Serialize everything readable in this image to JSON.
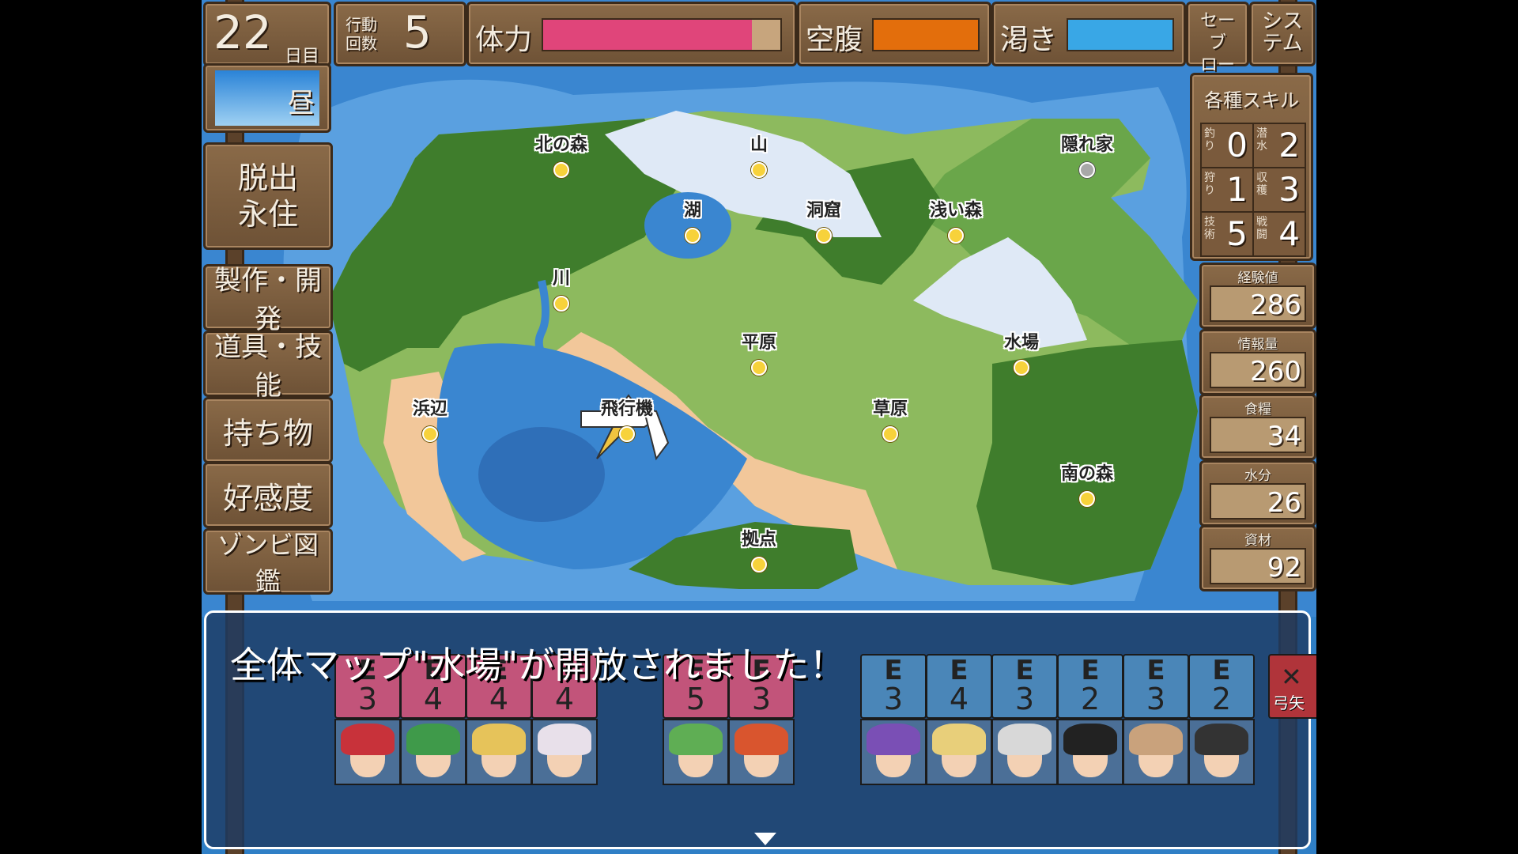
{
  "status": {
    "day_number": "22",
    "day_unit": "日目",
    "time_of_day": "昼",
    "actions_label_line1": "行動",
    "actions_label_line2": "回数",
    "actions_count": "5",
    "stamina_label": "体力",
    "stamina_level": 0.88,
    "hunger_label": "空腹",
    "hunger_level": 1.0,
    "thirst_label": "渇き",
    "thirst_level": 1.0,
    "save_label_line1": "セーブ",
    "save_label_line2": "ロード",
    "system_label_line1": "シス",
    "system_label_line2": "テム",
    "colors": {
      "stamina": "#e0457a",
      "hunger": "#e36e0c",
      "thirst": "#39a7e6"
    }
  },
  "menu": {
    "escape_line1": "脱出",
    "escape_line2": "永住",
    "items": [
      "製作・開発",
      "道具・技能",
      "持ち物",
      "好感度",
      "ゾンビ図鑑"
    ]
  },
  "skills": {
    "title": "各種スキル",
    "cells": [
      {
        "tag": "釣り",
        "value": "0"
      },
      {
        "tag": "潜水",
        "value": "2"
      },
      {
        "tag": "狩り",
        "value": "1"
      },
      {
        "tag": "収穫",
        "value": "3"
      },
      {
        "tag": "技術",
        "value": "5"
      },
      {
        "tag": "戦闘",
        "value": "4"
      }
    ]
  },
  "resources": [
    {
      "label": "経験値",
      "value": "286"
    },
    {
      "label": "情報量",
      "value": "260"
    },
    {
      "label": "食糧",
      "value": "34"
    },
    {
      "label": "水分",
      "value": "26"
    },
    {
      "label": "資材",
      "value": "92"
    }
  ],
  "map": {
    "locations": [
      {
        "name": "北の森",
        "id": "north-forest"
      },
      {
        "name": "山",
        "id": "mountain"
      },
      {
        "name": "隠れ家",
        "id": "hideout",
        "locked": true
      },
      {
        "name": "湖",
        "id": "lake"
      },
      {
        "name": "洞窟",
        "id": "cave"
      },
      {
        "name": "浅い森",
        "id": "shallow-forest"
      },
      {
        "name": "川",
        "id": "river"
      },
      {
        "name": "平原",
        "id": "plains"
      },
      {
        "name": "水場",
        "id": "water-spot"
      },
      {
        "name": "浜辺",
        "id": "beach"
      },
      {
        "name": "飛行機",
        "id": "airplane"
      },
      {
        "name": "草原",
        "id": "grassland"
      },
      {
        "name": "南の森",
        "id": "south-forest"
      },
      {
        "name": "拠点",
        "id": "base"
      }
    ]
  },
  "message": {
    "text": "全体マップ\"水場\"が開放されました！"
  },
  "party": {
    "group1": [
      {
        "e": "E",
        "num": "3",
        "hair": "#c8323a"
      },
      {
        "e": "E",
        "num": "4",
        "hair": "#3f9a4a"
      },
      {
        "e": "E",
        "num": "4",
        "hair": "#e6c35a"
      },
      {
        "e": "E",
        "num": "4",
        "hair": "#e8e0ea"
      }
    ],
    "group2": [
      {
        "e": "E",
        "num": "5",
        "hair": "#5fae54"
      },
      {
        "e": "E",
        "num": "3",
        "hair": "#d9552e"
      }
    ],
    "group3": [
      {
        "e": "E",
        "num": "3",
        "hair": "#7a4fb5"
      },
      {
        "e": "E",
        "num": "4",
        "hair": "#e8cf7a"
      },
      {
        "e": "E",
        "num": "3",
        "hair": "#d8d8d8"
      },
      {
        "e": "E",
        "num": "2",
        "hair": "#222222"
      },
      {
        "e": "E",
        "num": "3",
        "hair": "#c9a27c"
      },
      {
        "e": "E",
        "num": "2",
        "hair": "#333333"
      }
    ],
    "weapon_label": "弓矢",
    "colors": {
      "female_card": "#c2547a",
      "male_card": "#4a86b8"
    }
  }
}
